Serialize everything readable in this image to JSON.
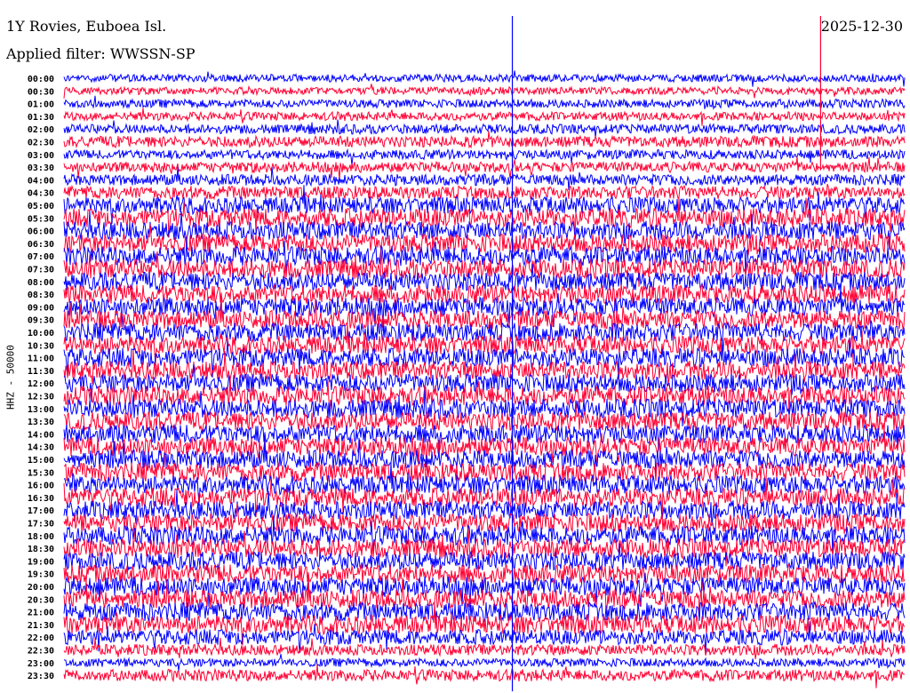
{
  "header": {
    "station": "1Y Rovies, Euboea Isl.",
    "filter": "Applied filter: WWSSN-SP",
    "date": "2025-12-30"
  },
  "chart_data": {
    "type": "line",
    "title": "1Y Rovies, Euboea Isl.",
    "subtitle": "Applied filter: WWSSN-SP",
    "ylabel": "HHZ - 50000",
    "xlabel": "",
    "row_labels": [
      "00:00",
      "00:30",
      "01:00",
      "01:30",
      "02:00",
      "02:30",
      "03:00",
      "03:30",
      "04:00",
      "04:30",
      "05:00",
      "05:30",
      "06:00",
      "06:30",
      "07:00",
      "07:30",
      "08:00",
      "08:30",
      "09:00",
      "09:30",
      "10:00",
      "10:30",
      "11:00",
      "11:30",
      "12:00",
      "12:30",
      "13:00",
      "13:30",
      "14:00",
      "14:30",
      "15:00",
      "15:30",
      "16:00",
      "16:30",
      "17:00",
      "17:30",
      "18:00",
      "18:30",
      "19:00",
      "19:30",
      "20:00",
      "20:30",
      "21:00",
      "21:30",
      "22:00",
      "22:30",
      "23:00",
      "23:30"
    ],
    "series_colors": [
      "#0000ff",
      "#ff0033"
    ],
    "relative_amplitude": [
      0.4,
      0.4,
      0.45,
      0.45,
      0.5,
      0.6,
      0.5,
      0.55,
      0.6,
      0.7,
      0.9,
      1,
      1,
      1,
      1,
      1,
      1,
      1,
      1,
      1,
      1,
      1,
      1,
      1,
      1,
      1,
      1,
      1,
      1,
      1,
      1,
      1,
      1,
      1,
      1,
      1,
      1,
      1,
      1,
      1,
      1,
      1,
      1,
      1,
      0.8,
      0.6,
      0.45,
      0.6
    ],
    "events": [
      {
        "row_from": "00:00",
        "row_to": "23:30",
        "minute": 16,
        "color": "#0000ff"
      },
      {
        "row_from": "00:00",
        "row_to": "03:00",
        "minute": 27,
        "color": "#ff0033"
      }
    ]
  }
}
